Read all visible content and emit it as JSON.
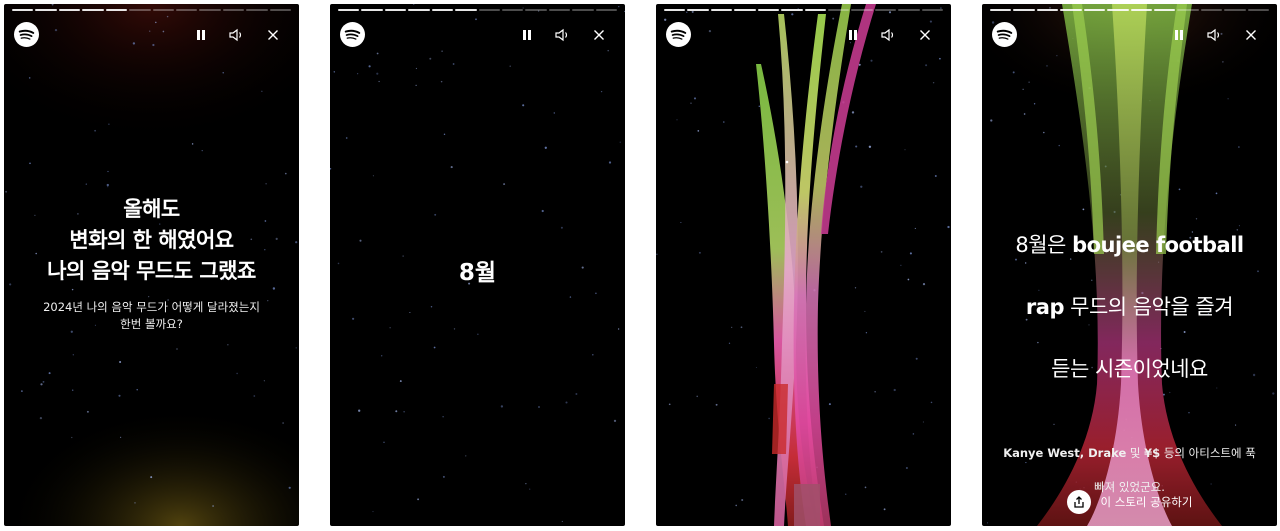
{
  "colors": {
    "background": "#000000",
    "progress_done": "#e6e6e6",
    "progress_pending": "#4d4d4d",
    "ribbon_green": "#8fc94a",
    "ribbon_pink": "#e0479e",
    "ribbon_red": "#d02a2a"
  },
  "icons": {
    "logo": "spotify-logo-icon",
    "pause": "pause-icon",
    "volume": "volume-icon",
    "close": "close-icon",
    "share": "share-icon"
  },
  "stories": [
    {
      "progress": {
        "segments": 12,
        "completed": 5
      },
      "headline": "올해도\n변화의 한 해였어요\n나의 음악 무드도 그랬죠",
      "subline": "2024년 나의 음악 무드가 어떻게 달라졌는지\n한번 볼까요?"
    },
    {
      "progress": {
        "segments": 12,
        "completed": 6
      },
      "headline": "8월"
    },
    {
      "progress": {
        "segments": 12,
        "completed": 7
      }
    },
    {
      "progress": {
        "segments": 12,
        "completed": 8
      },
      "headline_line1_prefix": "8월은 ",
      "headline_line1_bold": "boujee football",
      "headline_line2_bold": "rap",
      "headline_line2_rest": " 무드의 음악을 즐겨",
      "headline_line3": "듣는 시즌이었네요",
      "subline_bold_1": "Kanye West, Drake",
      "subline_mid_1": " 및 ",
      "subline_bold_2": "¥$",
      "subline_rest_1": " 등의 아티스트에 푹",
      "subline_line2": "빠져 있었군요.",
      "share_label": "이 스토리 공유하기"
    }
  ]
}
